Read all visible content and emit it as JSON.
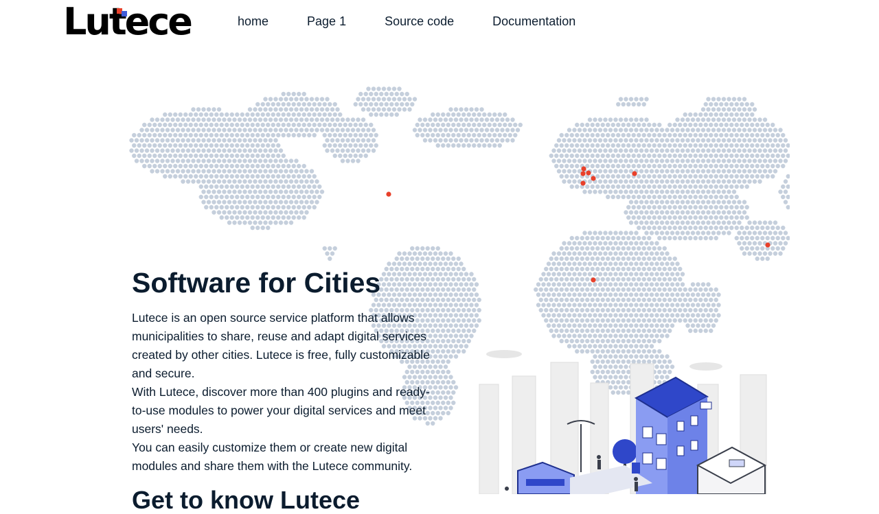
{
  "header": {
    "logo_text": "Lutece",
    "nav": [
      {
        "label": "home"
      },
      {
        "label": "Page 1"
      },
      {
        "label": "Source code"
      },
      {
        "label": "Documentation"
      }
    ]
  },
  "hero": {
    "title": "Software for Cities",
    "paragraphs": [
      "Lutece is an open source service platform that allows municipalities to share, reuse and adapt digital services created by other cities. Lutece is free, fully customizable and secure.",
      "With Lutece, discover more than 400 plugins and ready-to-use modules to power your digital services and meet users' needs.",
      "You can easily customize them or create new digital modules and share them with the Lutece community."
    ],
    "next_heading": "Get to know Lutece"
  },
  "colors": {
    "text": "#0b1c2e",
    "map_dot": "#c5cfdc",
    "city_dot": "#e8402a",
    "building_blue": "#8a9cf2",
    "building_roof": "#2f47c9"
  },
  "icons": {
    "map": "world-dot-map",
    "illustration": "city-buildings-illustration"
  }
}
